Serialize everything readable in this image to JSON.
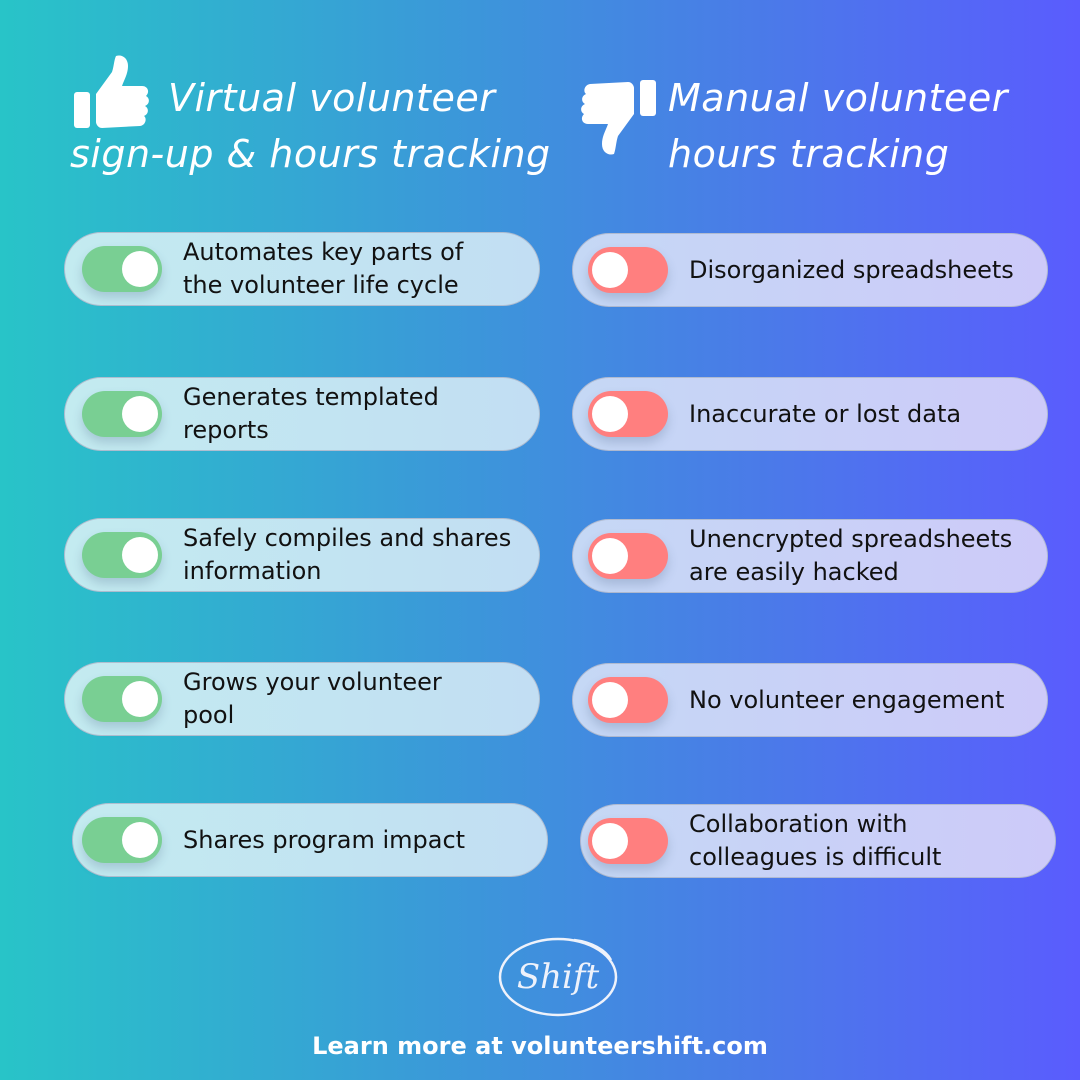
{
  "left_column": {
    "heading_lines": [
      "Virtual volunteer",
      "sign-up & hours tracking"
    ],
    "icon": "thumbs-up-icon",
    "toggle_state": "on",
    "toggle_color": "#79cf93",
    "items": [
      {
        "lines": [
          "Automates key parts of",
          "the volunteer life cycle"
        ]
      },
      {
        "lines": [
          "Generates templated",
          "reports"
        ]
      },
      {
        "lines": [
          "Safely compiles and shares",
          "information"
        ]
      },
      {
        "lines": [
          "Grows your volunteer",
          "pool"
        ]
      },
      {
        "lines": [
          "Shares program impact"
        ]
      }
    ]
  },
  "right_column": {
    "heading_lines": [
      "Manual volunteer",
      "hours tracking"
    ],
    "icon": "thumbs-down-icon",
    "toggle_state": "off",
    "toggle_color": "#ff7f7f",
    "items": [
      {
        "lines": [
          "Disorganized spreadsheets"
        ]
      },
      {
        "lines": [
          "Inaccurate or lost data"
        ]
      },
      {
        "lines": [
          "Unencrypted spreadsheets",
          "are easily hacked"
        ]
      },
      {
        "lines": [
          "No volunteer engagement"
        ]
      },
      {
        "lines": [
          "Collaboration with",
          "colleagues is difficult"
        ]
      }
    ]
  },
  "logo": {
    "text": "Shift"
  },
  "footer": {
    "text": "Learn more at volunteershift.com"
  },
  "colors": {
    "gradient_start": "#28c4c8",
    "gradient_end": "#5a5cfe"
  }
}
